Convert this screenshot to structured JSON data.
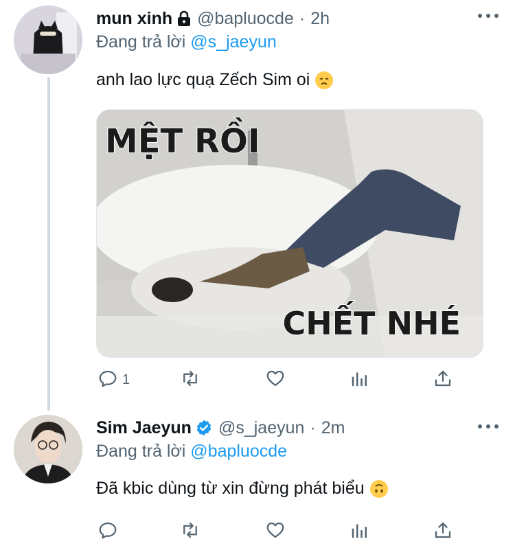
{
  "tweets": [
    {
      "display_name": "mun xinh",
      "handle": "@bapluocde",
      "time": "2h",
      "reply_prefix": "Đang trả lời",
      "reply_to": "@s_jaeyun",
      "text": "anh lao lực quạ Zếch Sim oi",
      "emoji_name": "disappointed-face-emoji",
      "media_text_top": "MỆT RỒI",
      "media_text_bottom": "CHẾT NHÉ",
      "reply_count": "1",
      "locked": true
    },
    {
      "display_name": "Sim Jaeyun",
      "handle": "@s_jaeyun",
      "time": "2m",
      "reply_prefix": "Đang trả lời",
      "reply_to": "@bapluocde",
      "text": "Đã kbic dùng từ xin đừng phát biểu",
      "emoji_name": "upside-down-face-emoji",
      "verified": true
    }
  ],
  "separator": "·",
  "colors": {
    "accent": "#1d9bf0",
    "muted": "#536471",
    "text": "#0f1419",
    "thread": "#cfd9de"
  }
}
